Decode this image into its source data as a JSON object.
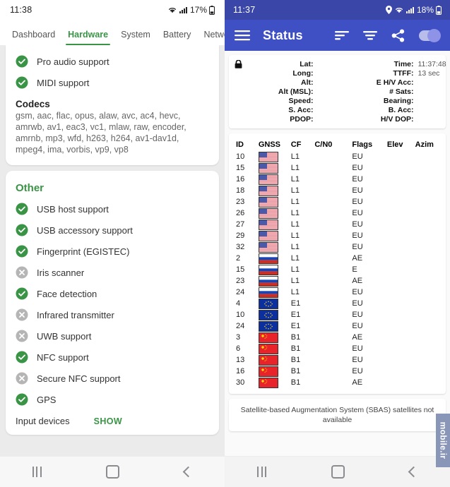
{
  "left_phone": {
    "status_bar": {
      "time": "11:38",
      "battery_percent": "17%",
      "icons": [
        "wifi-icon",
        "signal-icon",
        "battery-icon"
      ]
    },
    "tabs": [
      {
        "label": "Dashboard",
        "active": false
      },
      {
        "label": "Hardware",
        "active": true
      },
      {
        "label": "System",
        "active": false
      },
      {
        "label": "Battery",
        "active": false
      },
      {
        "label": "Networ",
        "active": false
      }
    ],
    "accent_color": "#3a9446",
    "card_audio": {
      "features": [
        {
          "label": "Pro audio support",
          "state": "yes"
        },
        {
          "label": "MIDI support",
          "state": "yes"
        }
      ],
      "codecs_title": "Codecs",
      "codecs_list": "gsm, aac, flac, opus, alaw, avc, ac4, hevc, amrwb, av1, eac3, vc1, mlaw, raw, encoder, amrnb, mp3, wfd, h263, h264, av1-dav1d, mpeg4, ima, vorbis, vp9, vp8"
    },
    "card_other": {
      "title": "Other",
      "features": [
        {
          "label": "USB host support",
          "state": "yes"
        },
        {
          "label": "USB accessory support",
          "state": "yes"
        },
        {
          "label": "Fingerprint (EGISTEC)",
          "state": "yes"
        },
        {
          "label": "Iris scanner",
          "state": "no"
        },
        {
          "label": "Face detection",
          "state": "yes"
        },
        {
          "label": "Infrared transmitter",
          "state": "no"
        },
        {
          "label": "UWB support",
          "state": "no"
        },
        {
          "label": "NFC support",
          "state": "yes"
        },
        {
          "label": "Secure NFC support",
          "state": "no"
        },
        {
          "label": "GPS",
          "state": "yes"
        }
      ],
      "input_devices_label": "Input devices",
      "input_devices_action": "SHOW"
    },
    "nav_bar": {
      "recents": "recents-icon",
      "home": "home-icon",
      "back": "back-icon"
    }
  },
  "right_phone": {
    "status_bar": {
      "time": "11:37",
      "battery_percent": "18%",
      "icons": [
        "location-icon",
        "wifi-icon",
        "signal-icon",
        "battery-icon"
      ]
    },
    "app_bar": {
      "menu_icon": "hamburger-menu-icon",
      "title": "Status",
      "sort_icon": "sort-icon",
      "filter_icon": "filter-icon",
      "share_icon": "share-icon",
      "toggle_state": "on",
      "background_color": "#3f4fc4"
    },
    "fix_panel": {
      "lock_icon": "lock-icon",
      "left_rows": [
        {
          "label": "Lat:",
          "value": ""
        },
        {
          "label": "Long:",
          "value": ""
        },
        {
          "label": "Alt:",
          "value": ""
        },
        {
          "label": "Alt (MSL):",
          "value": ""
        },
        {
          "label": "Speed:",
          "value": ""
        },
        {
          "label": "S. Acc:",
          "value": ""
        },
        {
          "label": "PDOP:",
          "value": ""
        }
      ],
      "right_rows": [
        {
          "label": "Time:",
          "value": "11:37:48"
        },
        {
          "label": "TTFF:",
          "value": "13 sec"
        },
        {
          "label": "E H/V Acc:",
          "value": ""
        },
        {
          "label": "# Sats:",
          "value": ""
        },
        {
          "label": "Bearing:",
          "value": ""
        },
        {
          "label": "B. Acc:",
          "value": ""
        },
        {
          "label": "H/V DOP:",
          "value": ""
        }
      ]
    },
    "satellite_table": {
      "columns": [
        "ID",
        "GNSS",
        "CF",
        "C/N0",
        "Flags",
        "Elev",
        "Azim"
      ],
      "rows": [
        {
          "id": "10",
          "gnss": "us-flag",
          "cf": "L1",
          "cn0": "",
          "flags": "EU",
          "elev": "",
          "azim": ""
        },
        {
          "id": "15",
          "gnss": "us-flag",
          "cf": "L1",
          "cn0": "",
          "flags": "EU",
          "elev": "",
          "azim": ""
        },
        {
          "id": "16",
          "gnss": "us-flag",
          "cf": "L1",
          "cn0": "",
          "flags": "EU",
          "elev": "",
          "azim": ""
        },
        {
          "id": "18",
          "gnss": "us-flag",
          "cf": "L1",
          "cn0": "",
          "flags": "EU",
          "elev": "",
          "azim": ""
        },
        {
          "id": "23",
          "gnss": "us-flag",
          "cf": "L1",
          "cn0": "",
          "flags": "EU",
          "elev": "",
          "azim": ""
        },
        {
          "id": "26",
          "gnss": "us-flag",
          "cf": "L1",
          "cn0": "",
          "flags": "EU",
          "elev": "",
          "azim": ""
        },
        {
          "id": "27",
          "gnss": "us-flag",
          "cf": "L1",
          "cn0": "",
          "flags": "EU",
          "elev": "",
          "azim": ""
        },
        {
          "id": "29",
          "gnss": "us-flag",
          "cf": "L1",
          "cn0": "",
          "flags": "EU",
          "elev": "",
          "azim": ""
        },
        {
          "id": "32",
          "gnss": "us-flag",
          "cf": "L1",
          "cn0": "",
          "flags": "EU",
          "elev": "",
          "azim": ""
        },
        {
          "id": "2",
          "gnss": "ru-flag",
          "cf": "L1",
          "cn0": "",
          "flags": "AE",
          "elev": "",
          "azim": ""
        },
        {
          "id": "15",
          "gnss": "ru-flag",
          "cf": "L1",
          "cn0": "",
          "flags": "E",
          "elev": "",
          "azim": ""
        },
        {
          "id": "23",
          "gnss": "ru-flag",
          "cf": "L1",
          "cn0": "",
          "flags": "AE",
          "elev": "",
          "azim": ""
        },
        {
          "id": "24",
          "gnss": "ru-flag",
          "cf": "L1",
          "cn0": "",
          "flags": "EU",
          "elev": "",
          "azim": ""
        },
        {
          "id": "4",
          "gnss": "eu-flag",
          "cf": "E1",
          "cn0": "",
          "flags": "EU",
          "elev": "",
          "azim": ""
        },
        {
          "id": "10",
          "gnss": "eu-flag",
          "cf": "E1",
          "cn0": "",
          "flags": "EU",
          "elev": "",
          "azim": ""
        },
        {
          "id": "24",
          "gnss": "eu-flag",
          "cf": "E1",
          "cn0": "",
          "flags": "EU",
          "elev": "",
          "azim": ""
        },
        {
          "id": "3",
          "gnss": "cn-flag",
          "cf": "B1",
          "cn0": "",
          "flags": "AE",
          "elev": "",
          "azim": ""
        },
        {
          "id": "6",
          "gnss": "cn-flag",
          "cf": "B1",
          "cn0": "",
          "flags": "EU",
          "elev": "",
          "azim": ""
        },
        {
          "id": "13",
          "gnss": "cn-flag",
          "cf": "B1",
          "cn0": "",
          "flags": "EU",
          "elev": "",
          "azim": ""
        },
        {
          "id": "16",
          "gnss": "cn-flag",
          "cf": "B1",
          "cn0": "",
          "flags": "EU",
          "elev": "",
          "azim": ""
        },
        {
          "id": "30",
          "gnss": "cn-flag",
          "cf": "B1",
          "cn0": "",
          "flags": "AE",
          "elev": "",
          "azim": ""
        }
      ]
    },
    "sbas_note": "Satellite-based Augmentation System (SBAS) satellites not available",
    "nav_bar": {
      "recents": "recents-icon",
      "home": "home-icon",
      "back": "back-icon"
    }
  },
  "watermark": {
    "text": "mobile.ir"
  }
}
